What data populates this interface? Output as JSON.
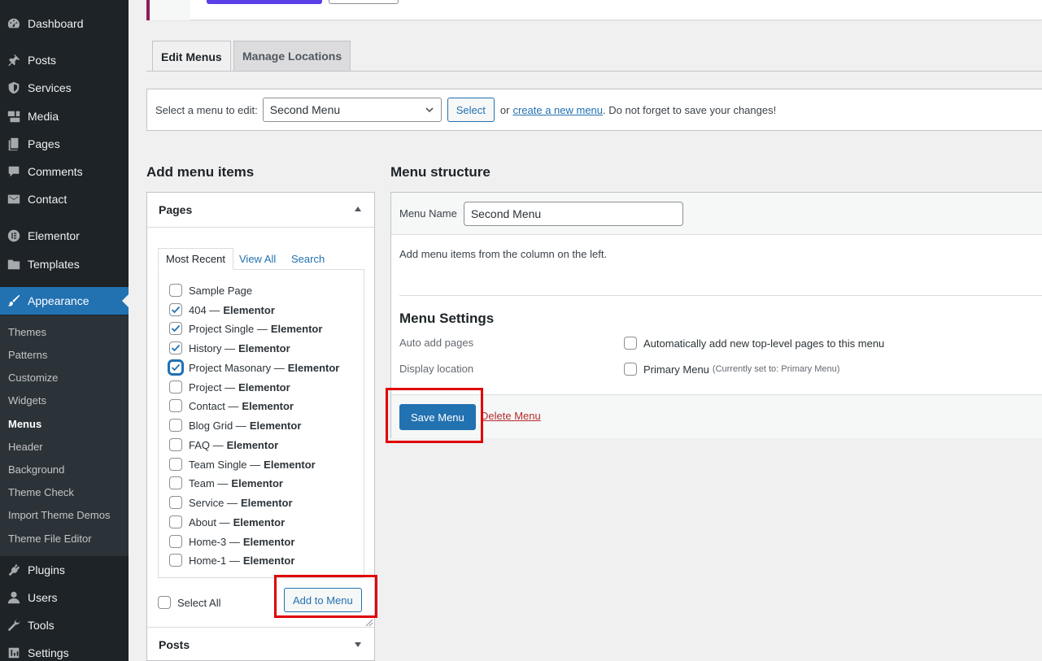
{
  "sidebar": {
    "items": [
      {
        "label": "Dashboard",
        "icon": "dashboard-icon"
      },
      {
        "label": "Posts",
        "icon": "pin-icon"
      },
      {
        "label": "Services",
        "icon": "shield-icon"
      },
      {
        "label": "Media",
        "icon": "media-icon"
      },
      {
        "label": "Pages",
        "icon": "pages-icon"
      },
      {
        "label": "Comments",
        "icon": "comment-icon"
      },
      {
        "label": "Contact",
        "icon": "envelope-icon"
      },
      {
        "label": "Elementor",
        "icon": "elementor-icon"
      },
      {
        "label": "Templates",
        "icon": "folder-icon"
      },
      {
        "label": "Appearance",
        "icon": "brush-icon"
      },
      {
        "label": "Plugins",
        "icon": "plugin-icon"
      },
      {
        "label": "Users",
        "icon": "user-icon"
      },
      {
        "label": "Tools",
        "icon": "wrench-icon"
      },
      {
        "label": "Settings",
        "icon": "settings-icon"
      }
    ],
    "appearance_submenu": [
      "Themes",
      "Patterns",
      "Customize",
      "Widgets",
      "Menus",
      "Header",
      "Background",
      "Theme Check",
      "Import Theme Demos",
      "Theme File Editor"
    ],
    "current_submenu": "Menus"
  },
  "tabs": {
    "edit": "Edit Menus",
    "manage": "Manage Locations"
  },
  "select_menu": {
    "label": "Select a menu to edit:",
    "selected": "Second Menu",
    "button": "Select",
    "or_text": "or",
    "create_link": "create a new menu",
    "reminder": ". Do not forget to save your changes!"
  },
  "add_items": {
    "title": "Add menu items",
    "pages_heading": "Pages",
    "inner_tabs": [
      "Most Recent",
      "View All",
      "Search"
    ],
    "pages": [
      {
        "name": "Sample Page",
        "suffix": "",
        "checked": false
      },
      {
        "name": "404 —",
        "suffix": "Elementor",
        "checked": true
      },
      {
        "name": "Project Single —",
        "suffix": "Elementor",
        "checked": true
      },
      {
        "name": "History —",
        "suffix": "Elementor",
        "checked": true
      },
      {
        "name": "Project Masonary —",
        "suffix": "Elementor",
        "checked": true
      },
      {
        "name": "Project —",
        "suffix": "Elementor",
        "checked": false
      },
      {
        "name": "Contact —",
        "suffix": "Elementor",
        "checked": false
      },
      {
        "name": "Blog Grid —",
        "suffix": "Elementor",
        "checked": false
      },
      {
        "name": "FAQ —",
        "suffix": "Elementor",
        "checked": false
      },
      {
        "name": "Team Single —",
        "suffix": "Elementor",
        "checked": false
      },
      {
        "name": "Team —",
        "suffix": "Elementor",
        "checked": false
      },
      {
        "name": "Service —",
        "suffix": "Elementor",
        "checked": false
      },
      {
        "name": "About —",
        "suffix": "Elementor",
        "checked": false
      },
      {
        "name": "Home-3 —",
        "suffix": "Elementor",
        "checked": false
      },
      {
        "name": "Home-1 —",
        "suffix": "Elementor",
        "checked": false
      }
    ],
    "select_all": "Select All",
    "add_button": "Add to Menu",
    "posts_heading": "Posts"
  },
  "structure": {
    "title": "Menu structure",
    "menu_name_label": "Menu Name",
    "menu_name_value": "Second Menu",
    "instructions": "Add menu items from the column on the left.",
    "settings_title": "Menu Settings",
    "auto_add_label": "Auto add pages",
    "auto_add_option": "Automatically add new top-level pages to this menu",
    "display_label": "Display location",
    "primary_option": "Primary Menu",
    "primary_note": "(Currently set to: Primary Menu)",
    "save_button": "Save Menu",
    "delete_link": "Delete Menu"
  },
  "colors": {
    "sidebar_bg": "#1d2327",
    "accent": "#2271b1",
    "highlight": "#e00000",
    "delete": "#b32d2e"
  }
}
